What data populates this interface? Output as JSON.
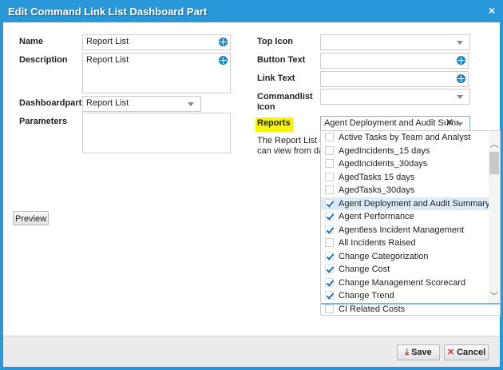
{
  "dialog": {
    "title": "Edit Command Link List Dashboard Part",
    "close": "×"
  },
  "left": {
    "name_label": "Name",
    "name_value": "Report List",
    "description_label": "Description",
    "description_value": "Report List",
    "dashboardparts_label": "Dashboardparts",
    "dashboardparts_value": "Report List",
    "parameters_label": "Parameters",
    "parameters_value": "",
    "preview_label": "Preview"
  },
  "right": {
    "top_icon_label": "Top Icon",
    "button_text_label": "Button Text",
    "link_text_label": "Link Text",
    "commandlist_icon_label": "Commandlist Icon",
    "reports_label": "Reports",
    "reports_value": "Agent Deployment and Audit Sumr",
    "help_line1": "The Report List da",
    "help_line2": "can view from das"
  },
  "reports_options": [
    {
      "label": "Active Tasks by Team and Analyst",
      "checked": false
    },
    {
      "label": "AgedIncidents_15 days",
      "checked": false
    },
    {
      "label": "AgedIncidents_30days",
      "checked": false
    },
    {
      "label": "AgedTasks 15 days",
      "checked": false
    },
    {
      "label": "AgedTasks_30days",
      "checked": false
    },
    {
      "label": "Agent Deployment and Audit Summary",
      "checked": true,
      "highlighted": true
    },
    {
      "label": "Agent Performance",
      "checked": true
    },
    {
      "label": "Agentless Incident Management",
      "checked": true
    },
    {
      "label": "All Incidents Raised",
      "checked": false
    },
    {
      "label": "Change Categorization",
      "checked": true
    },
    {
      "label": "Change Cost",
      "checked": true
    },
    {
      "label": "Change Management Scorecard",
      "checked": true
    },
    {
      "label": "Change Trend",
      "checked": true
    },
    {
      "label": "CI Related Costs",
      "checked": false
    }
  ],
  "footer": {
    "save_label": "Save",
    "cancel_label": "Cancel"
  }
}
